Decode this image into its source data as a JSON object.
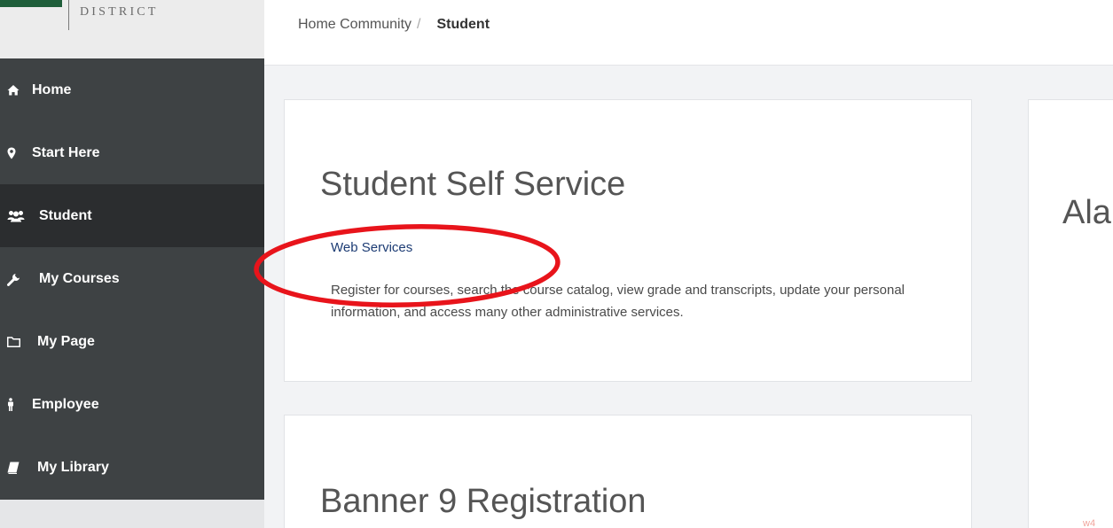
{
  "logo": {
    "text": "DISTRICT",
    "brand_color": "#1f5e3a"
  },
  "breadcrumb": {
    "home": "Home Community",
    "separator": "/",
    "current": "Student"
  },
  "sidebar": {
    "background": "#3e4244",
    "active_background": "#2b2d2f",
    "items": [
      {
        "label": "Home",
        "icon": "home-icon",
        "active": false
      },
      {
        "label": "Start Here",
        "icon": "map-marker-icon",
        "active": false
      },
      {
        "label": "Student",
        "icon": "users-icon",
        "active": true
      },
      {
        "label": "My Courses",
        "icon": "wrench-icon",
        "active": false
      },
      {
        "label": "My Page",
        "icon": "folder-icon",
        "active": false
      },
      {
        "label": "Employee",
        "icon": "person-icon",
        "active": false
      },
      {
        "label": "My Library",
        "icon": "book-icon",
        "active": false
      }
    ]
  },
  "cards": [
    {
      "title": "Student Self Service",
      "link": "Web Services",
      "description": "Register for courses, search the course catalog, view grade and transcripts, update your personal information, and access many other administrative services."
    },
    {
      "title": "Banner 9 Registration"
    },
    {
      "title": "Ala",
      "stray_text": "w4"
    }
  ],
  "annotation": {
    "shape": "ellipse",
    "color": "#e8141b",
    "target": "Web Services"
  }
}
